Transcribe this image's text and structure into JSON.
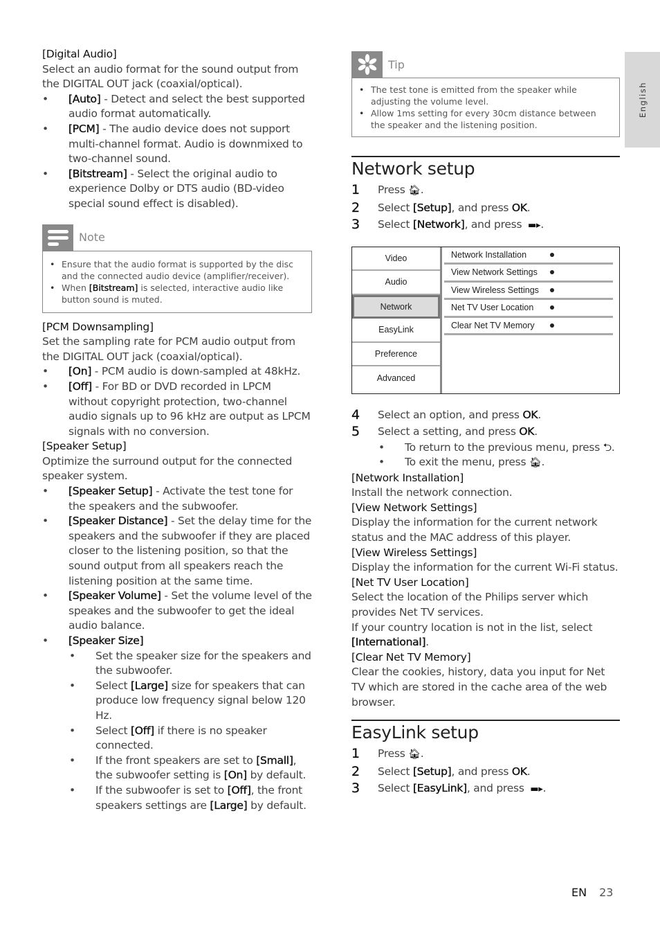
{
  "side_tab": {
    "label": "English"
  },
  "left": {
    "digital_audio": {
      "heading": "[Digital Audio]",
      "desc": "Select an audio format for the sound output from the DIGITAL OUT jack (coaxial/optical).",
      "options": [
        {
          "term": "[Auto]",
          "text": " - Detect and select the best supported audio format automatically."
        },
        {
          "term": "[PCM]",
          "text": " - The audio device does not support multi-channel format. Audio is downmixed to two-channel sound."
        },
        {
          "term": "[Bitstream]",
          "text": " - Select the original audio to experience Dolby or DTS audio (BD-video special sound effect is disabled)."
        }
      ]
    },
    "note": {
      "title": "Note",
      "icon": "note-lines-icon",
      "items": [
        {
          "pre": "Ensure that the audio format is supported by the disc and the connected audio device (amplifier/receiver).",
          "term": "",
          "post": ""
        },
        {
          "pre": "When ",
          "term": "[Bitstream]",
          "post": " is selected, interactive audio like button sound is muted."
        }
      ]
    },
    "pcm_downsampling": {
      "heading": "[PCM Downsampling]",
      "desc": "Set the sampling rate for PCM audio output from the DIGITAL OUT jack (coaxial/optical).",
      "options": [
        {
          "term": "[On]",
          "text": " - PCM audio is down-sampled at 48kHz."
        },
        {
          "term": "[Off]",
          "text": " - For BD or DVD recorded in LPCM without copyright protection, two-channel audio signals up to 96 kHz are output as LPCM signals with no conversion."
        }
      ]
    },
    "speaker_setup": {
      "heading": "[Speaker Setup]",
      "desc": "Optimize the surround output for the connected speaker system.",
      "options": [
        {
          "term": "[Speaker Setup]",
          "text": " - Activate the test tone for the speakers and the subwoofer."
        },
        {
          "term": "[Speaker Distance]",
          "text": " - Set the delay time for the speakers and the subwoofer if they are placed closer to the listening position, so that the sound output from all speakers reach the listening position at the same time."
        },
        {
          "term": "[Speaker Volume]",
          "text": " - Set the volume level of the speakes and the subwoofer to get the ideal audio balance."
        },
        {
          "term": "[Speaker Size]",
          "text": ""
        }
      ],
      "size_items": [
        {
          "p1": "Set the speaker size for the speakers and the subwoofer.",
          "t1": "",
          "p2": "",
          "t2": "",
          "p3": ""
        },
        {
          "p1": "Select ",
          "t1": "[Large]",
          "p2": " size for speakers that can produce low frequency signal below 120 Hz.",
          "t2": "",
          "p3": ""
        },
        {
          "p1": "Select ",
          "t1": "[Off]",
          "p2": " if there is no speaker connected.",
          "t2": "",
          "p3": ""
        },
        {
          "p1": "If the front speakers are set to ",
          "t1": "[Small]",
          "p2": ", the subwoofer setting is ",
          "t2": "[On]",
          "p3": " by default."
        },
        {
          "p1": "If the subwoofer is set to ",
          "t1": "[Off]",
          "p2": ", the front speakers settings are ",
          "t2": "[Large]",
          "p3": " by default."
        }
      ]
    }
  },
  "right": {
    "tip": {
      "title": "Tip",
      "icon": "asterisk-icon",
      "items": [
        "The test tone is emitted from the speaker while adjusting the volume level.",
        "Allow 1ms setting for every 30cm distance between the speaker and the listening position."
      ]
    },
    "network_setup": {
      "title": "Network setup",
      "steps": [
        {
          "num": "1",
          "pre": "Press ",
          "term": "",
          "post": "",
          "icon": "home-icon",
          "end": "."
        },
        {
          "num": "2",
          "pre": "Select ",
          "term": "[Setup]",
          "post": ", and press ",
          "key": "OK",
          "end": "."
        },
        {
          "num": "3",
          "pre": "Select ",
          "term": "[Network]",
          "post": ", and press ",
          "icon": "right-arrow-icon",
          "end": "."
        }
      ],
      "menu": {
        "left_items": [
          "Video",
          "Audio",
          "Network",
          "EasyLink",
          "Preference",
          "Advanced"
        ],
        "selected": "Network",
        "right_items": [
          "Network Installation",
          "View Network Settings",
          "View Wireless Settings",
          "Net TV User Location",
          "Clear Net TV Memory"
        ]
      },
      "steps2": [
        {
          "num": "4",
          "pre": "Select an option, and press ",
          "key": "OK",
          "end": "."
        },
        {
          "num": "5",
          "pre": "Select a setting, and press ",
          "key": "OK",
          "end": "."
        }
      ],
      "sub_bullets": [
        {
          "text": "To return to the previous menu, press ",
          "icon": "back-icon"
        },
        {
          "text": "To exit the menu, press ",
          "icon": "home-icon"
        }
      ],
      "definitions": [
        {
          "term": "[Network Installation]",
          "desc": "Install the network connection."
        },
        {
          "term": "[View Network Settings]",
          "desc": "Display the information for the current network status and the MAC address of this player."
        },
        {
          "term": "[View Wireless Settings]",
          "desc": "Display the information for the current Wi-Fi status."
        },
        {
          "term": "[Net TV User Location]",
          "desc": "Select the location of the Philips server which provides Net TV services.",
          "extra": "If your country location is not in the list, select ",
          "extra_term": "[International]",
          "extra_end": "."
        },
        {
          "term": "[Clear Net TV Memory]",
          "desc": "Clear the cookies, history, data you input for Net TV which are stored in the cache area of the web browser."
        }
      ]
    },
    "easylink_setup": {
      "title": "EasyLink setup",
      "steps": [
        {
          "num": "1",
          "pre": "Press ",
          "icon": "home-icon",
          "end": "."
        },
        {
          "num": "2",
          "pre": "Select ",
          "term": "[Setup]",
          "post": ", and press ",
          "key": "OK",
          "end": "."
        },
        {
          "num": "3",
          "pre": "Select ",
          "term": "[EasyLink]",
          "post": ", and press ",
          "icon": "right-arrow-icon",
          "end": "."
        }
      ]
    }
  },
  "footer": {
    "lang": "EN",
    "page": "23"
  }
}
